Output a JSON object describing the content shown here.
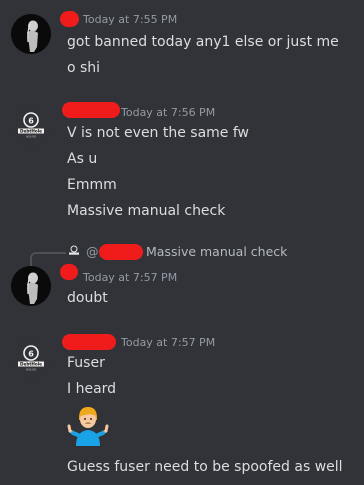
{
  "messages": [
    {
      "timestamp": "Today at 7:55 PM",
      "lines": [
        "got banned today any1 else or just me",
        "o shi"
      ]
    },
    {
      "timestamp": "Today at 7:56 PM",
      "lines": [
        "V is not even the same fw",
        "As u",
        "Emmm",
        "Massive manual check"
      ]
    },
    {
      "reply_at": "@",
      "reply_text": "Massive manual check",
      "timestamp": "Today at 7:57 PM",
      "lines": [
        "doubt"
      ]
    },
    {
      "timestamp": "Today at 7:57 PM",
      "lines": [
        "Fuser",
        "I heard",
        "Guess fuser need to be spoofed as well"
      ],
      "emoji": "person-shrugging-emoji"
    }
  ],
  "logo_text": [
    "DebtHole",
    "HOUSE"
  ],
  "colors": {
    "background": "#313338",
    "text": "#dbdee1",
    "muted": "#949ba4",
    "redaction": "#f01c1c"
  }
}
